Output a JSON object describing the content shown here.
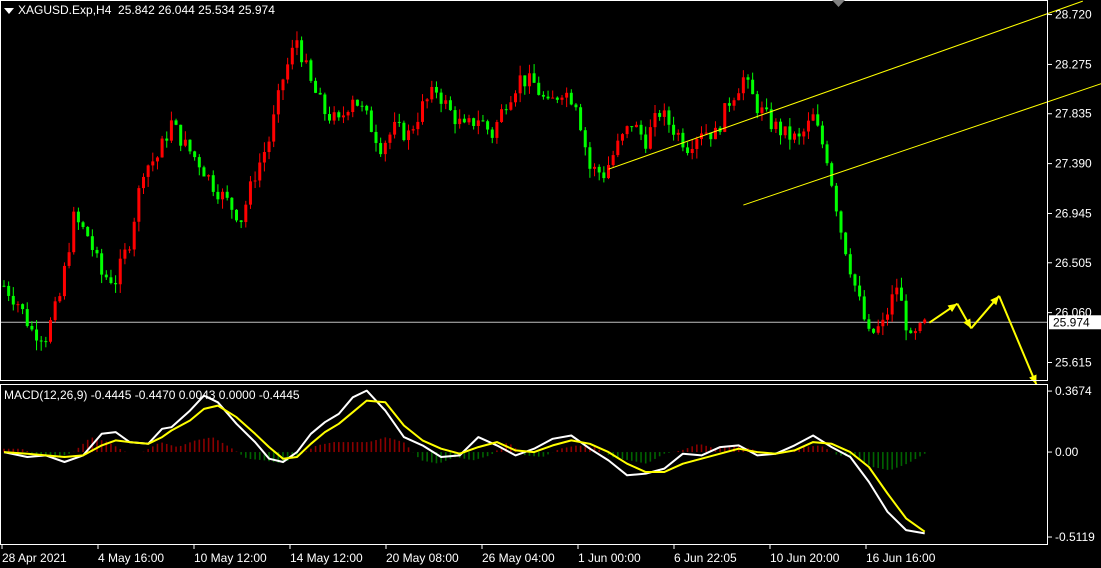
{
  "header": {
    "symbol": "XAGUSD.Exp,H4",
    "open": "25.842",
    "high": "26.044",
    "low": "25.534",
    "close": "25.974"
  },
  "macd_header": "MACD(12,26,9) -0.4445 -0.4470 0.0043 0.0000 -0.4445",
  "colors": {
    "bull": "#ff0000",
    "bear": "#00ff00",
    "channel": "#ffff00",
    "macd_line": "#ffffff",
    "signal_line": "#ffff00",
    "hist_pos": "#8b0000",
    "hist_neg": "#006400",
    "arrow": "#ffff00",
    "grid_axis": "#ffffff"
  },
  "chart_data": [
    {
      "type": "candlestick",
      "title": "XAGUSD.Exp,H4",
      "ylim": [
        25.45,
        28.85
      ],
      "y_ticks": [
        "28.720",
        "28.275",
        "27.835",
        "27.390",
        "26.945",
        "26.505",
        "26.060",
        "25.615"
      ],
      "current_price": "25.974",
      "current_price_value": 25.974,
      "x_ticks": [
        "28 Apr 2021",
        "4 May 16:00",
        "10 May 12:00",
        "14 May 12:00",
        "20 May 08:00",
        "26 May 04:00",
        "1 Jun 00:00",
        "6 Jun 22:05",
        "10 Jun 20:00",
        "16 Jun 16:00"
      ],
      "close_path": [
        [
          0,
          26.3
        ],
        [
          3,
          26.15
        ],
        [
          6,
          25.9
        ],
        [
          9,
          25.85
        ],
        [
          12,
          26.2
        ],
        [
          15,
          26.9
        ],
        [
          18,
          26.75
        ],
        [
          21,
          26.4
        ],
        [
          24,
          26.35
        ],
        [
          27,
          26.7
        ],
        [
          30,
          27.35
        ],
        [
          33,
          27.45
        ],
        [
          36,
          27.75
        ],
        [
          39,
          27.55
        ],
        [
          42,
          27.4
        ],
        [
          45,
          27.2
        ],
        [
          48,
          27.05
        ],
        [
          51,
          26.9
        ],
        [
          54,
          27.3
        ],
        [
          57,
          27.6
        ],
        [
          60,
          28.15
        ],
        [
          63,
          28.5
        ],
        [
          66,
          28.1
        ],
        [
          69,
          27.85
        ],
        [
          72,
          27.75
        ],
        [
          75,
          28.0
        ],
        [
          78,
          27.8
        ],
        [
          81,
          27.55
        ],
        [
          84,
          27.7
        ],
        [
          87,
          27.65
        ],
        [
          90,
          27.9
        ],
        [
          93,
          28.05
        ],
        [
          96,
          27.85
        ],
        [
          99,
          27.7
        ],
        [
          102,
          27.8
        ],
        [
          105,
          27.65
        ],
        [
          108,
          27.95
        ],
        [
          111,
          28.15
        ],
        [
          114,
          28.1
        ],
        [
          117,
          27.9
        ],
        [
          120,
          28.05
        ],
        [
          123,
          27.95
        ],
        [
          126,
          27.35
        ],
        [
          129,
          27.3
        ],
        [
          132,
          27.55
        ],
        [
          135,
          27.75
        ],
        [
          138,
          27.6
        ],
        [
          141,
          27.85
        ],
        [
          144,
          27.7
        ],
        [
          147,
          27.55
        ],
        [
          150,
          27.7
        ],
        [
          153,
          27.65
        ],
        [
          156,
          27.95
        ],
        [
          159,
          28.15
        ],
        [
          162,
          27.9
        ],
        [
          165,
          27.75
        ],
        [
          168,
          27.65
        ],
        [
          171,
          27.6
        ],
        [
          174,
          27.8
        ],
        [
          177,
          27.45
        ],
        [
          180,
          26.8
        ],
        [
          183,
          26.3
        ],
        [
          186,
          25.85
        ],
        [
          189,
          25.95
        ],
        [
          192,
          26.3
        ],
        [
          195,
          25.8
        ],
        [
          198,
          25.95
        ]
      ],
      "channel_lines": [
        {
          "x": [
            130.0,
            232
          ],
          "y": [
            27.34,
            28.84
          ]
        },
        {
          "x": [
            159,
            262
          ],
          "y": [
            27.02,
            28.47
          ]
        }
      ],
      "forecast_path": [
        [
          199,
          25.97
        ],
        [
          205,
          26.14
        ],
        [
          208,
          25.92
        ],
        [
          214,
          26.21
        ],
        [
          222,
          25.42
        ]
      ]
    },
    {
      "type": "line",
      "title": "MACD(12,26,9)",
      "ylim": [
        -0.56,
        0.41
      ],
      "y_ticks": [
        "0.3674",
        "0.00",
        "-0.5119"
      ],
      "series": [
        {
          "name": "MACD",
          "x": [
            0,
            5,
            9,
            13,
            17,
            21,
            24,
            27,
            31,
            34,
            36,
            40,
            43,
            46,
            50,
            54,
            57,
            60,
            63,
            66,
            69,
            72,
            75,
            78,
            82,
            86,
            90,
            94,
            98,
            102,
            106,
            110,
            114,
            118,
            122,
            126,
            130,
            134,
            138,
            142,
            146,
            150,
            154,
            158,
            162,
            166,
            170,
            174,
            178,
            182,
            186,
            190,
            194,
            198
          ],
          "values": [
            0.0,
            -0.03,
            -0.02,
            -0.06,
            -0.02,
            0.11,
            0.12,
            0.06,
            0.05,
            0.14,
            0.15,
            0.25,
            0.34,
            0.3,
            0.17,
            0.06,
            -0.04,
            -0.06,
            0.0,
            0.11,
            0.18,
            0.23,
            0.33,
            0.37,
            0.25,
            0.09,
            0.04,
            -0.03,
            -0.02,
            0.09,
            0.04,
            -0.02,
            0.02,
            0.08,
            0.1,
            0.02,
            -0.05,
            -0.14,
            -0.13,
            -0.1,
            -0.01,
            -0.02,
            0.03,
            0.04,
            -0.02,
            -0.01,
            0.04,
            0.1,
            0.03,
            -0.03,
            -0.18,
            -0.36,
            -0.47,
            -0.49
          ]
        },
        {
          "name": "Signal",
          "x": [
            0,
            5,
            9,
            13,
            17,
            21,
            24,
            27,
            31,
            34,
            36,
            40,
            43,
            46,
            50,
            54,
            57,
            60,
            63,
            66,
            69,
            72,
            75,
            78,
            82,
            86,
            90,
            94,
            98,
            102,
            106,
            110,
            114,
            118,
            122,
            126,
            130,
            134,
            138,
            142,
            146,
            150,
            154,
            158,
            162,
            166,
            170,
            174,
            178,
            182,
            186,
            190,
            194,
            198
          ],
          "values": [
            0.0,
            -0.01,
            -0.02,
            -0.03,
            -0.02,
            0.04,
            0.07,
            0.06,
            0.05,
            0.09,
            0.13,
            0.19,
            0.26,
            0.28,
            0.21,
            0.11,
            0.03,
            -0.04,
            -0.03,
            0.05,
            0.12,
            0.17,
            0.24,
            0.31,
            0.3,
            0.16,
            0.07,
            0.02,
            -0.01,
            0.03,
            0.06,
            0.01,
            0.0,
            0.04,
            0.07,
            0.05,
            0.0,
            -0.07,
            -0.12,
            -0.12,
            -0.07,
            -0.04,
            -0.01,
            0.02,
            0.0,
            -0.01,
            0.01,
            0.06,
            0.05,
            0.0,
            -0.09,
            -0.25,
            -0.4,
            -0.48
          ]
        }
      ],
      "histogram": [
        0.02,
        0.02,
        -0.02,
        -0.04,
        0.0,
        0.09,
        0.06,
        0.0,
        0.0,
        0.06,
        0.03,
        0.07,
        0.09,
        0.03,
        -0.04,
        -0.05,
        -0.07,
        -0.02,
        0.04,
        0.06,
        0.06,
        0.06,
        0.09,
        0.06,
        -0.05,
        -0.07,
        -0.03,
        -0.05,
        -0.02,
        0.06,
        -0.02,
        -0.03,
        0.02,
        0.04,
        0.03,
        -0.03,
        -0.05,
        -0.07,
        -0.01,
        0.01,
        0.05,
        0.02,
        0.04,
        0.02,
        -0.02,
        0.0,
        0.03,
        0.04,
        -0.02,
        -0.03,
        -0.09,
        -0.11,
        -0.07,
        -0.01
      ]
    }
  ]
}
